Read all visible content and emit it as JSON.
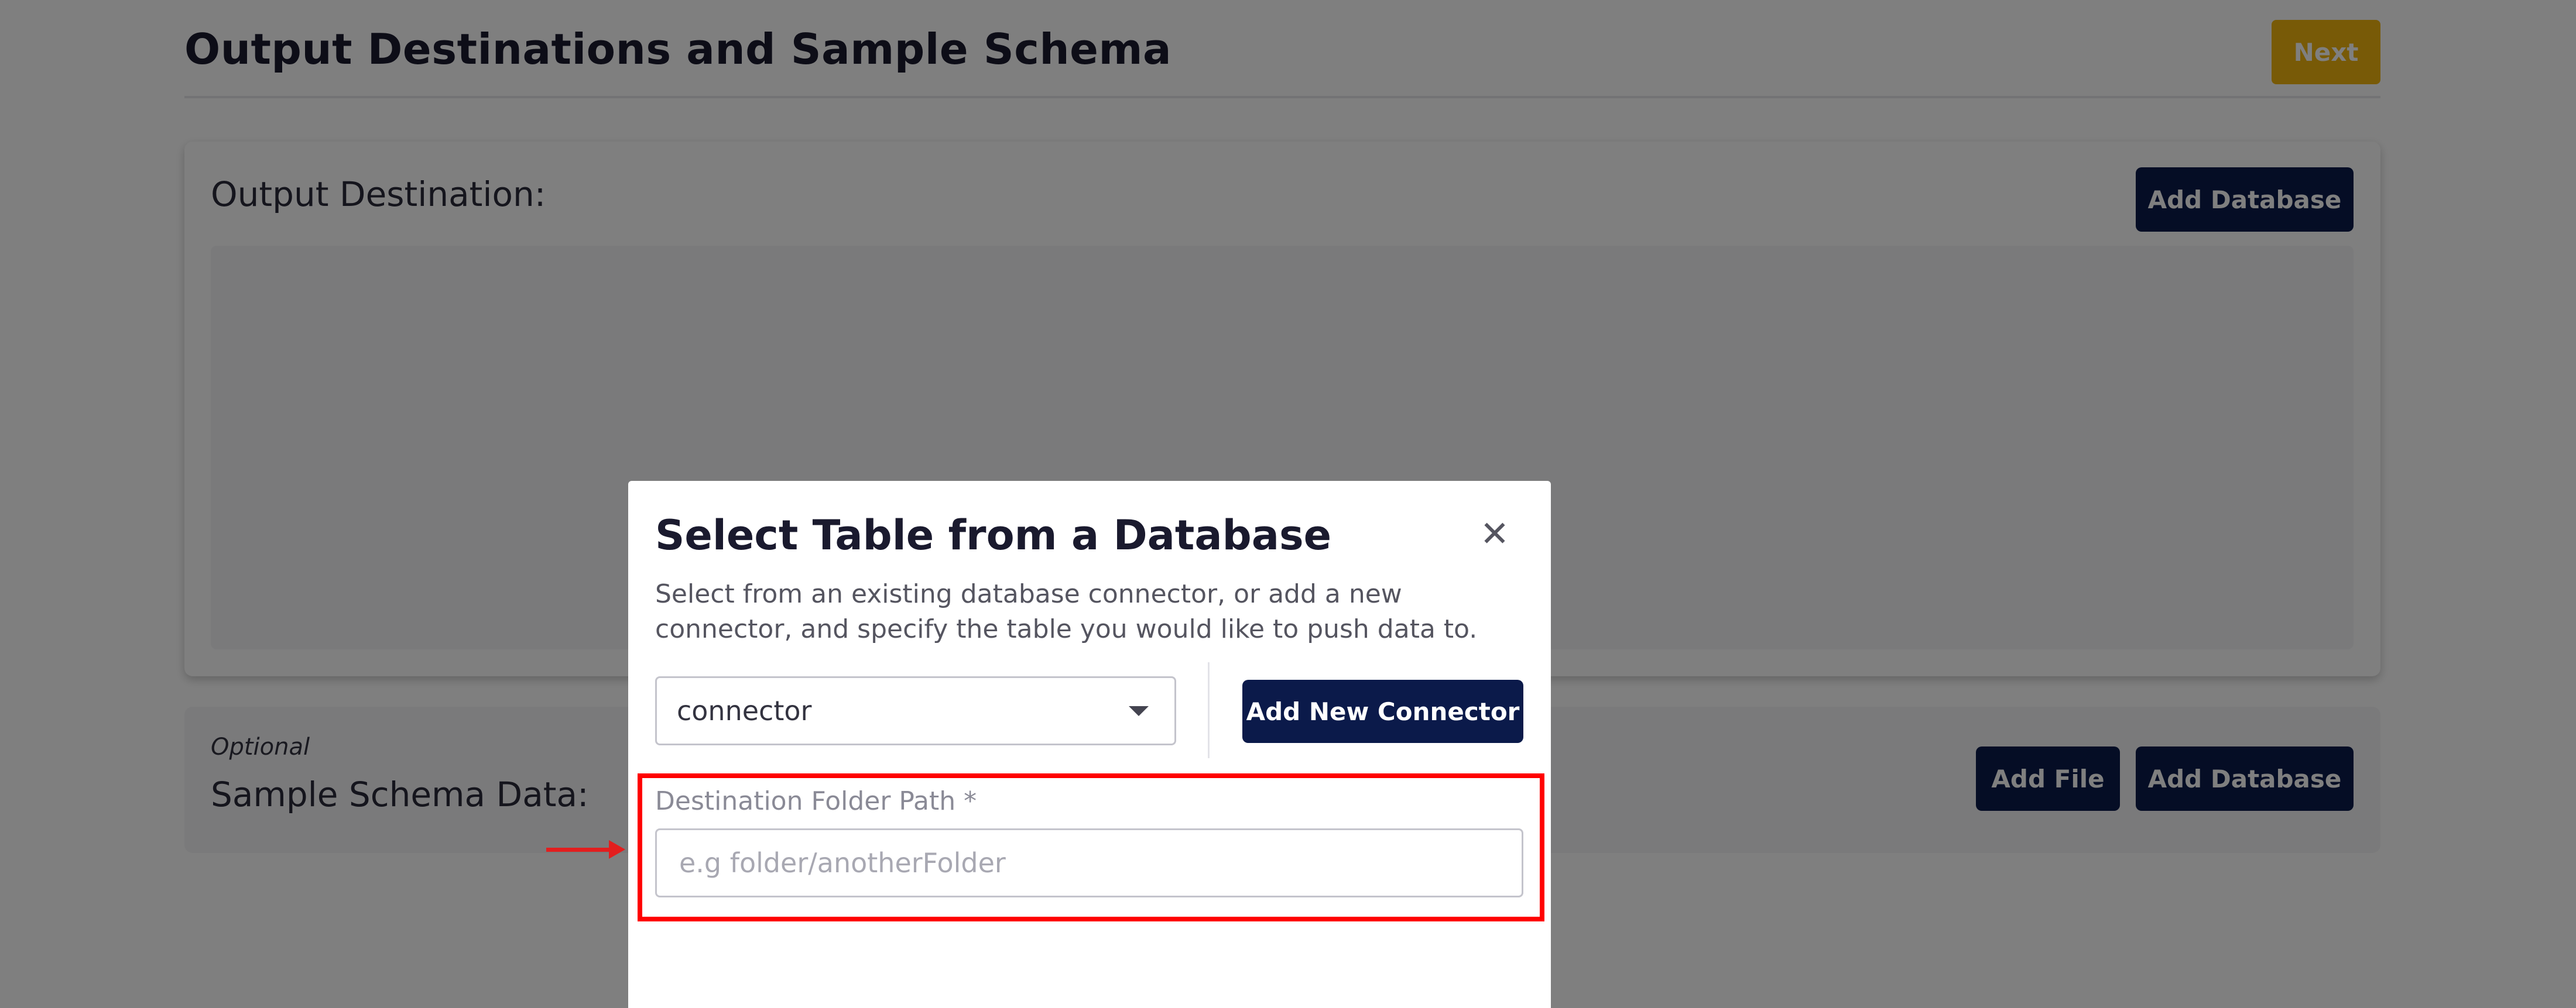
{
  "page": {
    "title": "Output Destinations and Sample Schema",
    "next_label": "Next"
  },
  "output_destination": {
    "heading": "Output Destination:",
    "add_database_label": "Add Database"
  },
  "sample_schema": {
    "optional_label": "Optional",
    "heading": "Sample Schema Data:",
    "add_file_label": "Add File",
    "add_database_label": "Add Database"
  },
  "modal": {
    "title": "Select Table from a Database",
    "close_icon": "close-icon",
    "description": "Select from an existing database connector, or add a new connector, and specify the table you would like to push data to.",
    "connector_select": {
      "selected_value": "connector",
      "icon": "chevron-down-icon"
    },
    "add_connector_label": "Add New Connector",
    "destination_path": {
      "label": "Destination Folder Path *",
      "placeholder": "e.g folder/anotherFolder",
      "value": ""
    }
  },
  "annotation": {
    "highlight_color": "#ff0000",
    "arrow_color": "#e31e1e"
  },
  "colors": {
    "accent_yellow": "#f1b40f",
    "navy": "#0b1a4a"
  }
}
